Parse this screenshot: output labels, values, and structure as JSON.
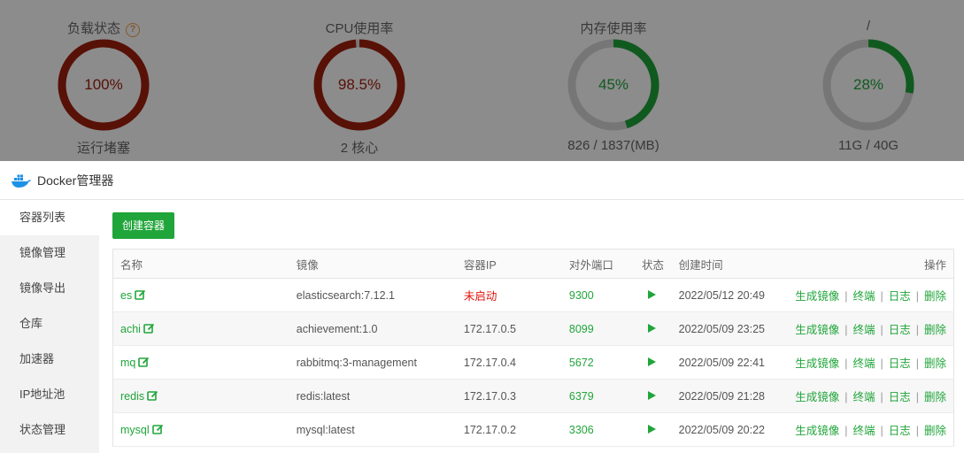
{
  "dashboard": {
    "gauges": [
      {
        "title": "负载状态",
        "value": "100%",
        "sub": "运行堵塞",
        "percent": 100,
        "color": "#a0200d",
        "help": "?"
      },
      {
        "title": "CPU使用率",
        "value": "98.5%",
        "sub": "2 核心",
        "percent": 98.5,
        "color": "#a0200d"
      },
      {
        "title": "内存使用率",
        "value": "45%",
        "sub": "826 / 1837(MB)",
        "percent": 45,
        "color": "#20a53a"
      },
      {
        "title": "/",
        "value": "28%",
        "sub": "11G / 40G",
        "percent": 28,
        "color": "#20a53a"
      }
    ]
  },
  "modal": {
    "title": "Docker管理器",
    "icon": "docker-whale-icon"
  },
  "sidebar": {
    "items": [
      {
        "label": "容器列表",
        "active": true
      },
      {
        "label": "镜像管理"
      },
      {
        "label": "镜像导出"
      },
      {
        "label": "仓库"
      },
      {
        "label": "加速器"
      },
      {
        "label": "IP地址池"
      },
      {
        "label": "状态管理"
      }
    ]
  },
  "toolbar": {
    "create_label": "创建容器"
  },
  "table": {
    "headers": [
      "名称",
      "镜像",
      "容器IP",
      "对外端口",
      "状态",
      "创建时间",
      "操作"
    ],
    "rows": [
      {
        "name": "es",
        "image": "elasticsearch:7.12.1",
        "ip": "未启动",
        "port": "9300",
        "created": "2022/05/12 20:49"
      },
      {
        "name": "achi",
        "image": "achievement:1.0",
        "ip": "172.17.0.5",
        "port": "8099",
        "created": "2022/05/09 23:25"
      },
      {
        "name": "mq",
        "image": "rabbitmq:3-management",
        "ip": "172.17.0.4",
        "port": "5672",
        "created": "2022/05/09 22:41"
      },
      {
        "name": "redis",
        "image": "redis:latest",
        "ip": "172.17.0.3",
        "port": "6379",
        "created": "2022/05/09 21:28"
      },
      {
        "name": "mysql",
        "image": "mysql:latest",
        "ip": "172.17.0.2",
        "port": "3306",
        "created": "2022/05/09 20:22"
      }
    ],
    "ops": [
      "生成镜像",
      "终端",
      "日志",
      "删除"
    ],
    "separator": "|"
  },
  "colors": {
    "accent": "#20a53a",
    "danger": "#e0120b"
  }
}
